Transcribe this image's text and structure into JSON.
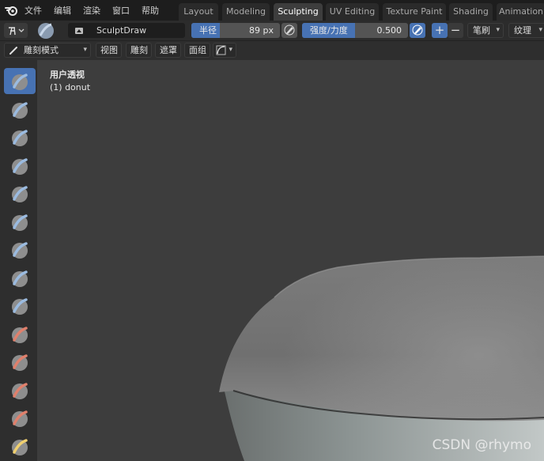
{
  "menu": [
    "文件",
    "编辑",
    "渲染",
    "窗口",
    "帮助"
  ],
  "workspaces": [
    {
      "label": "Layout",
      "active": false
    },
    {
      "label": "Modeling",
      "active": false
    },
    {
      "label": "Sculpting",
      "active": true
    },
    {
      "label": "UV Editing",
      "active": false
    },
    {
      "label": "Texture Paint",
      "active": false
    },
    {
      "label": "Shading",
      "active": false
    },
    {
      "label": "Animation",
      "active": false
    }
  ],
  "tool_header": {
    "brush_name": "SculptDraw",
    "radius_label": "半径",
    "radius_value": "89 px",
    "strength_label": "强度/力度",
    "strength_value": "0.500",
    "strength_fraction": 0.5,
    "plus": "+",
    "minus": "−",
    "stroke_label": "笔刷",
    "texture_label": "纹理"
  },
  "mode_header": {
    "mode_label": "雕刻模式",
    "view": "视图",
    "sculpt": "雕刻",
    "mask": "遮罩",
    "face_sets": "面组"
  },
  "toolbar": {
    "tools": [
      {
        "icon": "draw-brush-icon",
        "color": "#9bbbe0",
        "active": true
      },
      {
        "icon": "draw-sharp-brush-icon",
        "color": "#9bbbe0"
      },
      {
        "icon": "clay-brush-icon",
        "color": "#9bbbe0"
      },
      {
        "icon": "clay-strips-brush-icon",
        "color": "#9bbbe0"
      },
      {
        "icon": "clay-thumb-brush-icon",
        "color": "#9bbbe0"
      },
      {
        "icon": "layer-brush-icon",
        "color": "#9bbbe0"
      },
      {
        "icon": "inflate-brush-icon",
        "color": "#9bbbe0"
      },
      {
        "icon": "blob-brush-icon",
        "color": "#9bbbe0"
      },
      {
        "icon": "crease-brush-icon",
        "color": "#9bbbe0"
      },
      {
        "icon": "smooth-brush-icon",
        "color": "#e0806c"
      },
      {
        "icon": "flatten-brush-icon",
        "color": "#e0806c"
      },
      {
        "icon": "fill-brush-icon",
        "color": "#e0806c"
      },
      {
        "icon": "scrape-brush-icon",
        "color": "#e0806c"
      },
      {
        "icon": "multiplane-scrape-brush-icon",
        "color": "#f0d070"
      }
    ]
  },
  "viewport": {
    "title": "用户透视",
    "subtitle": "(1) donut",
    "watermark": "CSDN @rhymo"
  },
  "colors": {
    "accent": "#4772b3",
    "background": "#3d3d3d",
    "mesh": "#8a8a8a"
  }
}
